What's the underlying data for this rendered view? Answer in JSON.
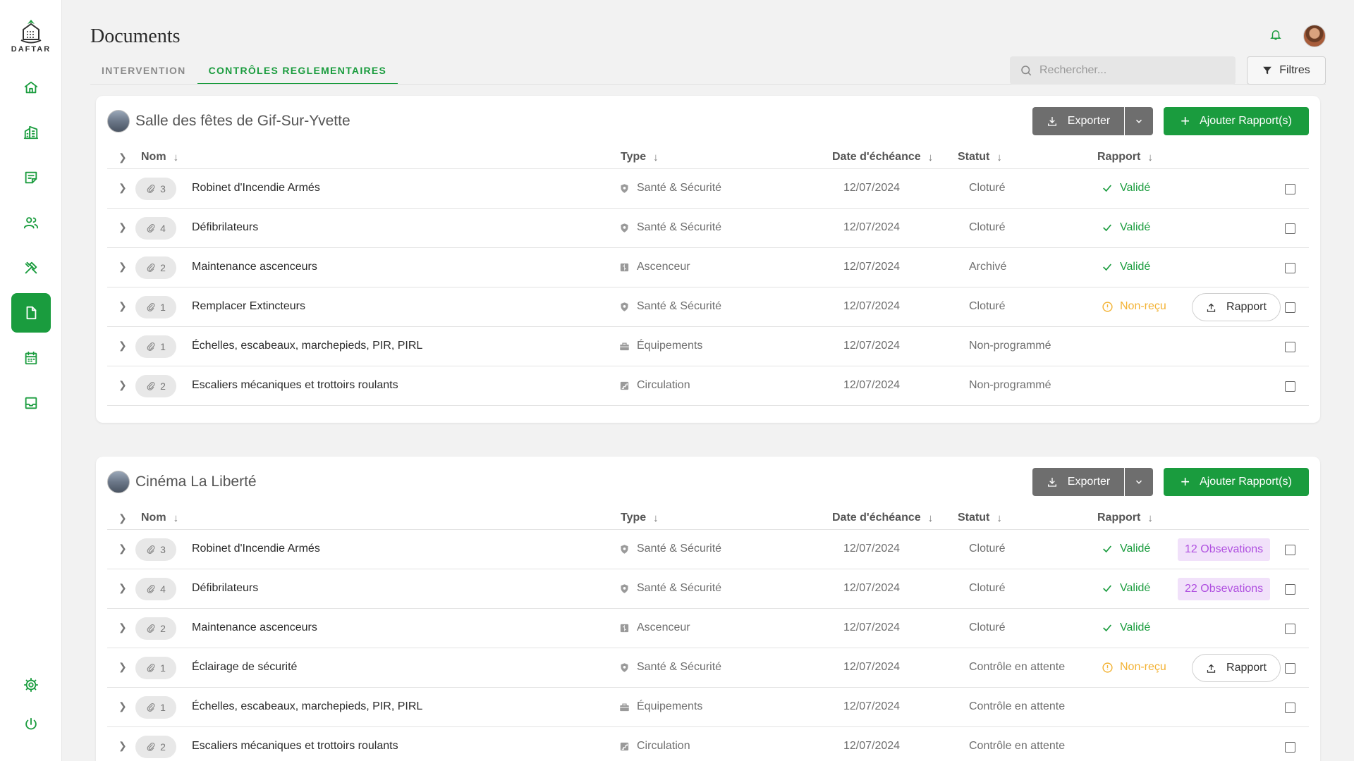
{
  "app": {
    "brand": "DAFTAR",
    "page_title": "Documents"
  },
  "tabs": [
    {
      "label": "INTERVENTION",
      "active": false
    },
    {
      "label": "CONTRÔLES REGLEMENTAIRES",
      "active": true
    }
  ],
  "search": {
    "placeholder": "Rechercher..."
  },
  "filters_label": "Filtres",
  "colors": {
    "accent": "#1a9c3e",
    "warning": "#f3b233",
    "observation": "#b050e0",
    "export": "#6e6e6e"
  },
  "sidebar": {
    "items": [
      {
        "icon": "home-icon",
        "active": false
      },
      {
        "icon": "buildings-icon",
        "active": false
      },
      {
        "icon": "notes-icon",
        "active": false
      },
      {
        "icon": "users-icon",
        "active": false
      },
      {
        "icon": "tools-icon",
        "active": false
      },
      {
        "icon": "document-icon",
        "active": true
      },
      {
        "icon": "calendar-icon",
        "active": false
      },
      {
        "icon": "inbox-icon",
        "active": false
      }
    ],
    "bottom": [
      {
        "icon": "gear-icon"
      },
      {
        "icon": "power-icon"
      }
    ]
  },
  "columns": {
    "name": "Nom",
    "type": "Type",
    "due": "Date d'échéance",
    "status": "Statut",
    "report": "Rapport"
  },
  "buttons": {
    "export": "Exporter",
    "add": "Ajouter Rapport(s)",
    "rapport": "Rapport"
  },
  "sites": [
    {
      "name": "Salle des fêtes de Gif-Sur-Yvette",
      "rows": [
        {
          "attachments": "3",
          "name": "Robinet d'Incendie Armés",
          "type": "Santé & Sécurité",
          "type_icon": "shield-icon",
          "date": "12/07/2024",
          "status": "Cloturé",
          "report": "Validé",
          "report_state": "valid",
          "observations": ""
        },
        {
          "attachments": "4",
          "name": "Défibrilateurs",
          "type": "Santé & Sécurité",
          "type_icon": "shield-icon",
          "date": "12/07/2024",
          "status": "Cloturé",
          "report": "Validé",
          "report_state": "valid",
          "observations": ""
        },
        {
          "attachments": "2",
          "name": "Maintenance ascenceurs",
          "type": "Ascenceur",
          "type_icon": "elevator-icon",
          "date": "12/07/2024",
          "status": "Archivé",
          "report": "Validé",
          "report_state": "valid",
          "observations": ""
        },
        {
          "attachments": "1",
          "name": "Remplacer Extincteurs",
          "type": "Santé & Sécurité",
          "type_icon": "shield-icon",
          "date": "12/07/2024",
          "status": "Cloturé",
          "report": "Non-reçu",
          "report_state": "pending",
          "observations": ""
        },
        {
          "attachments": "1",
          "name": "Échelles, escabeaux, marchepieds, PIR, PIRL",
          "type": "Équipements",
          "type_icon": "toolbox-icon",
          "date": "12/07/2024",
          "status": "Non-programmé",
          "report": "",
          "report_state": "none",
          "observations": ""
        },
        {
          "attachments": "2",
          "name": "Escaliers mécaniques et trottoirs roulants",
          "type": "Circulation",
          "type_icon": "stairs-icon",
          "date": "12/07/2024",
          "status": "Non-programmé",
          "report": "",
          "report_state": "none",
          "observations": ""
        }
      ]
    },
    {
      "name": "Cinéma La Liberté",
      "rows": [
        {
          "attachments": "3",
          "name": "Robinet d'Incendie Armés",
          "type": "Santé & Sécurité",
          "type_icon": "shield-icon",
          "date": "12/07/2024",
          "status": "Cloturé",
          "report": "Validé",
          "report_state": "valid",
          "observations": "12  Obsevations"
        },
        {
          "attachments": "4",
          "name": "Défibrilateurs",
          "type": "Santé & Sécurité",
          "type_icon": "shield-icon",
          "date": "12/07/2024",
          "status": "Cloturé",
          "report": "Validé",
          "report_state": "valid",
          "observations": "22 Obsevations"
        },
        {
          "attachments": "2",
          "name": "Maintenance ascenceurs",
          "type": "Ascenceur",
          "type_icon": "elevator-icon",
          "date": "12/07/2024",
          "status": "Cloturé",
          "report": "Validé",
          "report_state": "valid",
          "observations": ""
        },
        {
          "attachments": "1",
          "name": "Éclairage de sécurité",
          "type": "Santé & Sécurité",
          "type_icon": "shield-icon",
          "date": "12/07/2024",
          "status": "Contrôle en attente",
          "report": "Non-reçu",
          "report_state": "pending",
          "observations": ""
        },
        {
          "attachments": "1",
          "name": "Échelles, escabeaux, marchepieds, PIR, PIRL",
          "type": "Équipements",
          "type_icon": "toolbox-icon",
          "date": "12/07/2024",
          "status": "Contrôle en attente",
          "report": "",
          "report_state": "none",
          "observations": ""
        },
        {
          "attachments": "2",
          "name": "Escaliers mécaniques et trottoirs roulants",
          "type": "Circulation",
          "type_icon": "stairs-icon",
          "date": "12/07/2024",
          "status": "Contrôle en attente",
          "report": "",
          "report_state": "none",
          "observations": ""
        }
      ]
    }
  ]
}
